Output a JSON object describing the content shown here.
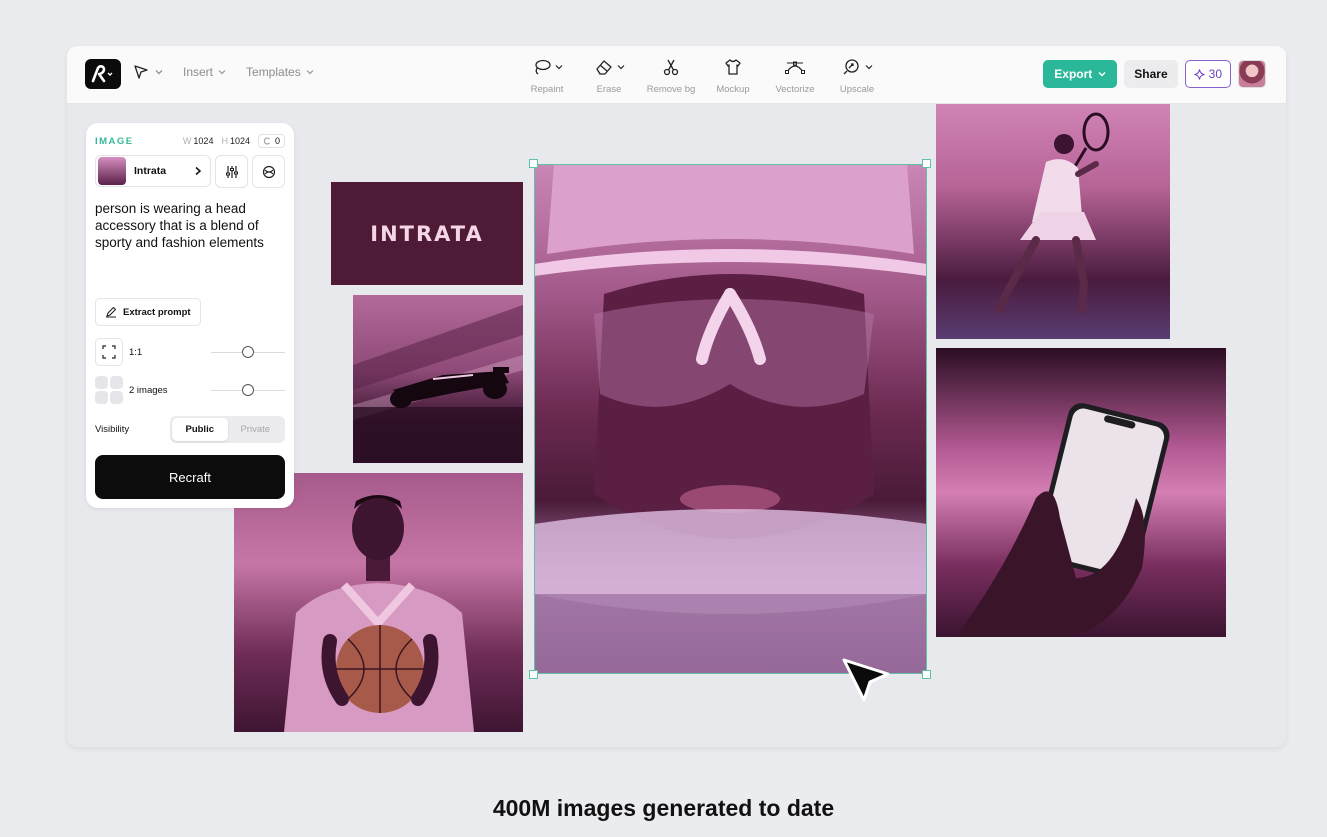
{
  "toolbar": {
    "menus": [
      "Insert",
      "Templates"
    ],
    "tools": [
      {
        "label": "Repaint",
        "icon": "lasso-icon"
      },
      {
        "label": "Erase",
        "icon": "eraser-icon"
      },
      {
        "label": "Remove bg",
        "icon": "scissors-icon"
      },
      {
        "label": "Mockup",
        "icon": "tshirt-icon"
      },
      {
        "label": "Vectorize",
        "icon": "vectorize-icon"
      },
      {
        "label": "Upscale",
        "icon": "upscale-icon"
      }
    ],
    "export_label": "Export",
    "share_label": "Share",
    "credits": "30"
  },
  "panel": {
    "title": "IMAGE",
    "width_label": "W",
    "width_value": "1024",
    "height_label": "H",
    "height_value": "1024",
    "seed_value": "0",
    "style_name": "Intrata",
    "prompt": "person is wearing a head accessory that is a blend of sporty and fashion elements",
    "extract_label": "Extract prompt",
    "ratio_label": "1:1",
    "count_label": "2 images",
    "visibility_label": "Visibility",
    "visibility_options": [
      "Public",
      "Private"
    ],
    "visibility_selected": "Public",
    "generate_label": "Recraft"
  },
  "canvas": {
    "brand_text": "INTRATA"
  },
  "colors": {
    "accent": "#2bb79a",
    "selection": "#5fc2a8",
    "credits": "#6d3fc0"
  },
  "caption": "400M images generated to date"
}
